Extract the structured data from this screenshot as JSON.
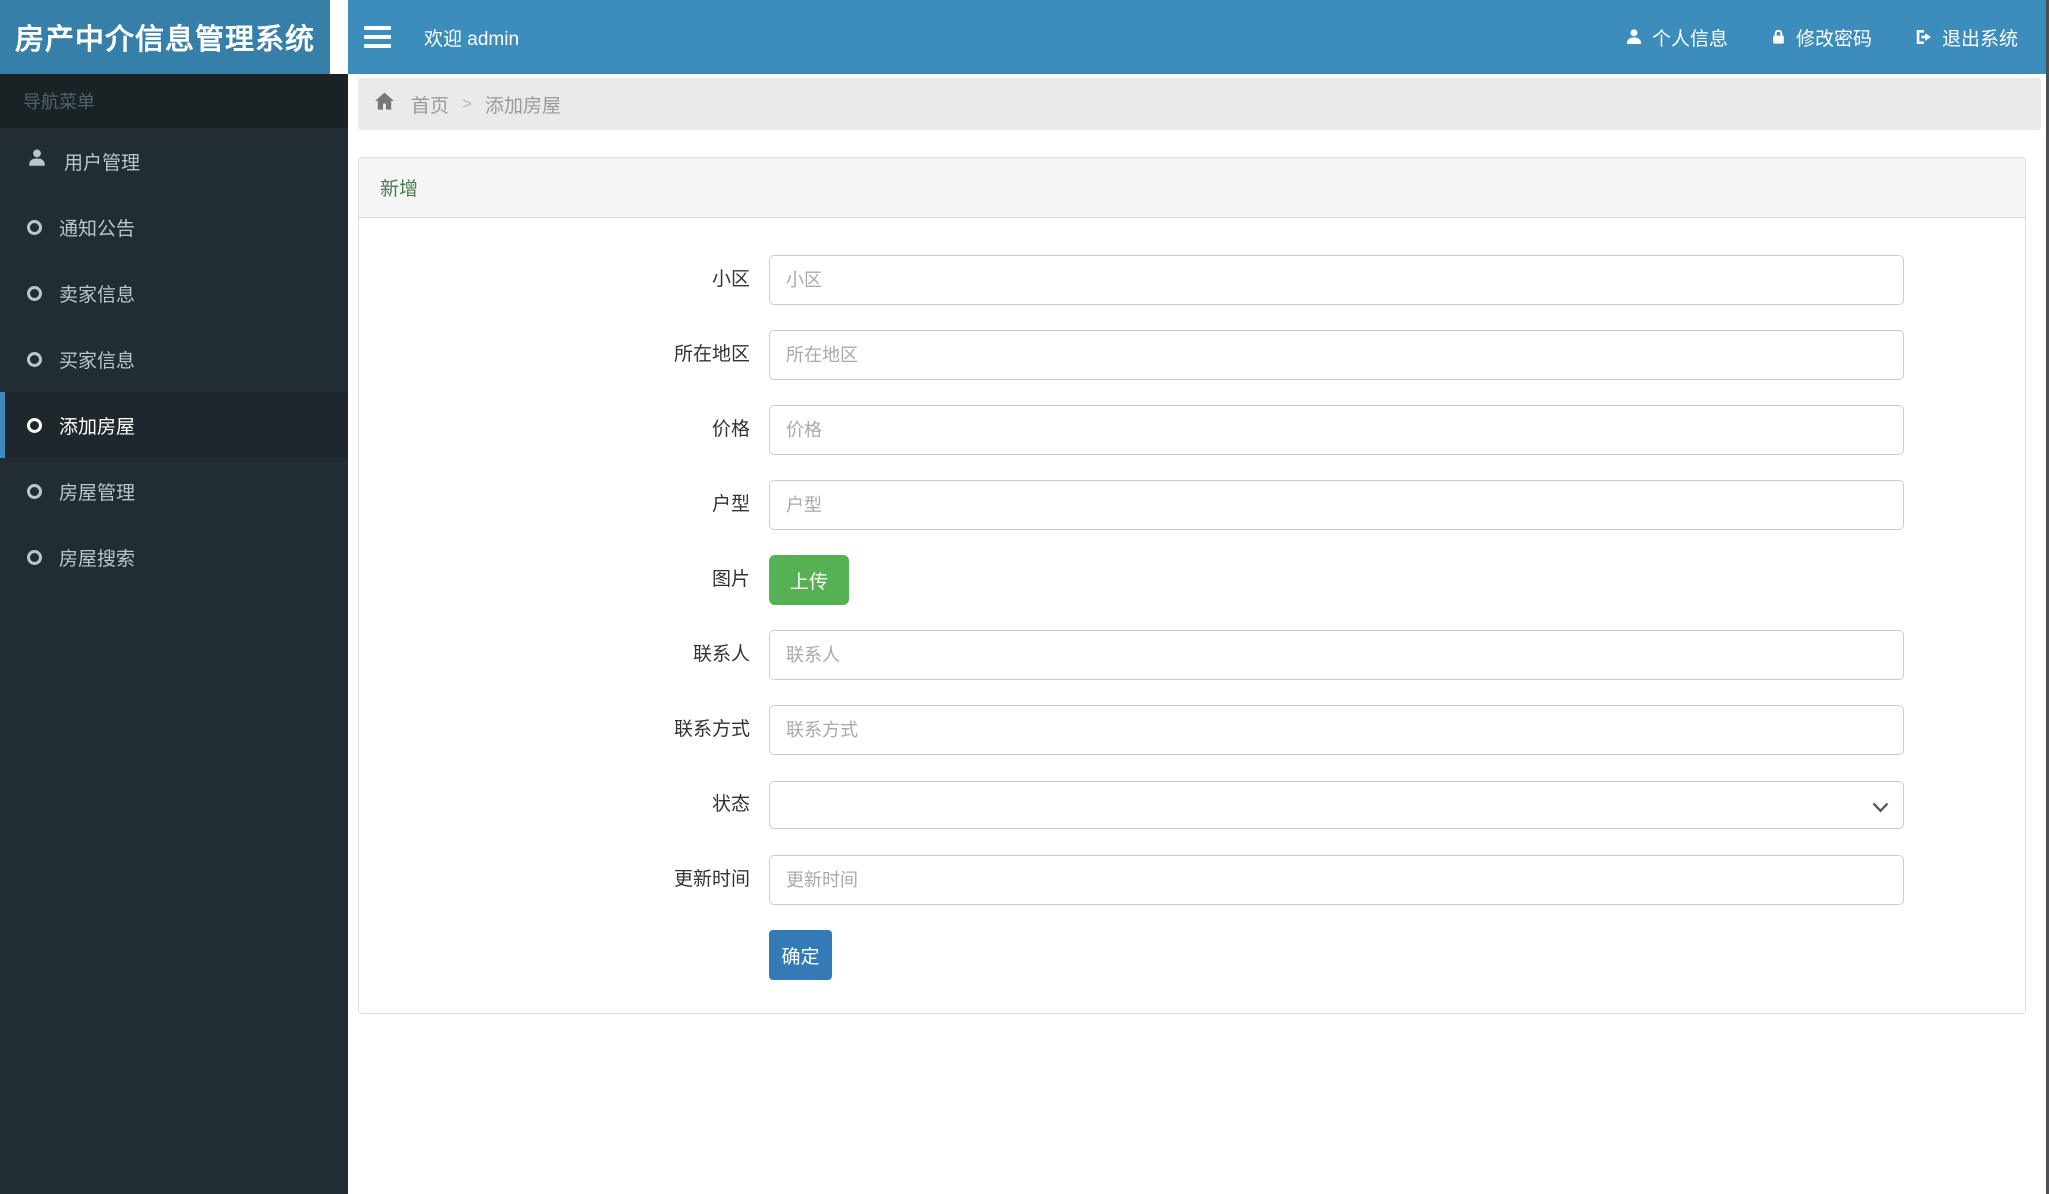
{
  "app": {
    "title": "房产中介信息管理系统"
  },
  "header": {
    "welcome": "欢迎 admin",
    "menu": [
      {
        "label": "个人信息",
        "icon": "user-icon"
      },
      {
        "label": "修改密码",
        "icon": "lock-icon"
      },
      {
        "label": "退出系统",
        "icon": "sign-out-icon"
      }
    ]
  },
  "sidebar": {
    "section_title": "导航菜单",
    "items": [
      {
        "label": "用户管理",
        "icon": "user-icon",
        "active": false
      },
      {
        "label": "通知公告",
        "icon": "circle-icon",
        "active": false
      },
      {
        "label": "卖家信息",
        "icon": "circle-icon",
        "active": false
      },
      {
        "label": "买家信息",
        "icon": "circle-icon",
        "active": false
      },
      {
        "label": "添加房屋",
        "icon": "circle-icon",
        "active": true
      },
      {
        "label": "房屋管理",
        "icon": "circle-icon",
        "active": false
      },
      {
        "label": "房屋搜索",
        "icon": "circle-icon",
        "active": false
      }
    ]
  },
  "breadcrumb": {
    "home": "首页",
    "separator": ">",
    "current": "添加房屋"
  },
  "panel": {
    "title": "新增",
    "fields": [
      {
        "label": "小区",
        "type": "text",
        "placeholder": "小区",
        "value": ""
      },
      {
        "label": "所在地区",
        "type": "text",
        "placeholder": "所在地区",
        "value": ""
      },
      {
        "label": "价格",
        "type": "text",
        "placeholder": "价格",
        "value": ""
      },
      {
        "label": "户型",
        "type": "text",
        "placeholder": "户型",
        "value": ""
      },
      {
        "label": "图片",
        "type": "upload",
        "button_label": "上传"
      },
      {
        "label": "联系人",
        "type": "text",
        "placeholder": "联系人",
        "value": ""
      },
      {
        "label": "联系方式",
        "type": "text",
        "placeholder": "联系方式",
        "value": ""
      },
      {
        "label": "状态",
        "type": "select",
        "selected": ""
      },
      {
        "label": "更新时间",
        "type": "text",
        "placeholder": "更新时间",
        "value": ""
      }
    ],
    "submit_label": "确定"
  },
  "colors": {
    "navbar_blue": "#3c8dbc",
    "logo_blue": "#367fa9",
    "sidebar_dark": "#222d32",
    "active_item_bg": "#1e282c",
    "panel_title_green": "#4a7b52",
    "upload_green": "#55b154",
    "submit_blue": "#337ab7"
  }
}
